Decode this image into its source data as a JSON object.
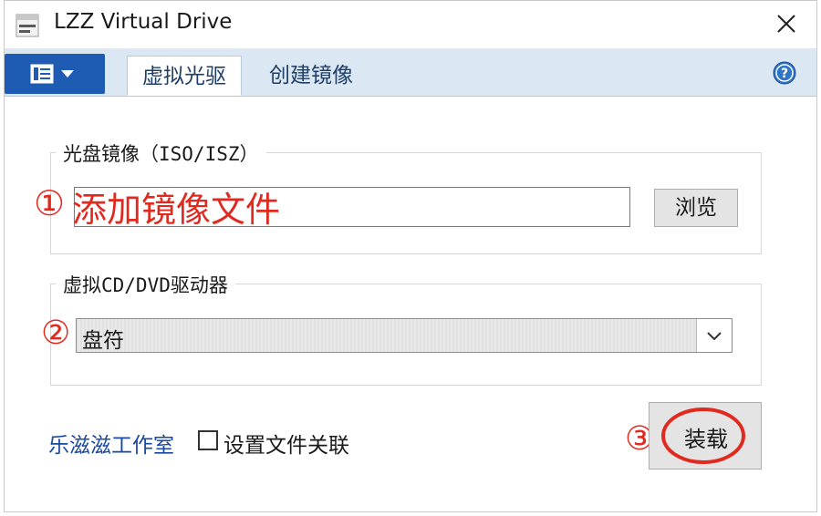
{
  "window": {
    "title": "LZZ Virtual Drive"
  },
  "tabs": {
    "active": "虚拟光驱",
    "second": "创建镜像"
  },
  "image_group": {
    "label": "光盘镜像（ISO/ISZ）",
    "input_value": "",
    "browse_label": "浏览",
    "annotation_number": "①",
    "annotation_text": "添加镜像文件"
  },
  "drive_group": {
    "label": "虚拟CD/DVD驱动器",
    "selected_value": "盘符",
    "annotation_number": "②"
  },
  "footer": {
    "studio_link": "乐滋滋工作室",
    "checkbox_label": "设置文件关联",
    "checkbox_checked": false,
    "mount_label": "装载",
    "annotation_number": "③"
  },
  "colors": {
    "accent": "#1e5bb2",
    "tab_bar": "#dce7f4",
    "annotation": "#e02a1f",
    "link": "#1848a4"
  },
  "icons": {
    "app": "app-drive-icon",
    "close": "close-icon",
    "menu": "menu-list-icon",
    "dropdown": "dropdown-caret-icon",
    "help": "help-icon",
    "chevron": "chevron-down-icon"
  }
}
